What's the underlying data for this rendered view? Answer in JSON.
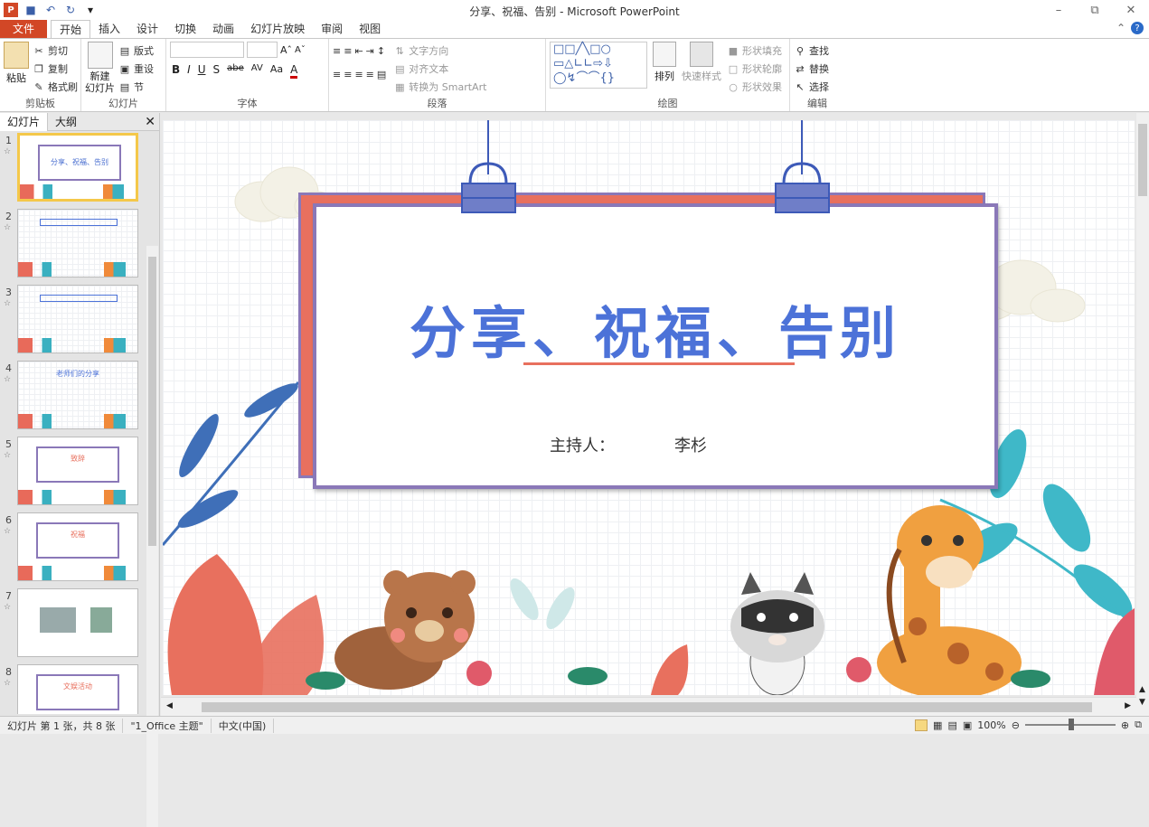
{
  "window": {
    "title": "分享、祝福、告别 - Microsoft PowerPoint",
    "app_icon": "P"
  },
  "tabs": [
    "文件",
    "开始",
    "插入",
    "设计",
    "切换",
    "动画",
    "幻灯片放映",
    "审阅",
    "视图"
  ],
  "ribbon": {
    "clipboard": {
      "label": "剪贴板",
      "paste": "粘贴",
      "cut": "剪切",
      "copy": "复制",
      "format_painter": "格式刷"
    },
    "slides": {
      "label": "幻灯片",
      "new_slide": "新建\n幻灯片",
      "layout": "版式",
      "reset": "重设",
      "section": "节"
    },
    "font": {
      "label": "字体",
      "buttons": [
        "B",
        "I",
        "U",
        "S",
        "abe",
        "AV",
        "Aa",
        "A"
      ]
    },
    "paragraph": {
      "label": "段落",
      "text_direction": "文字方向",
      "align_text": "对齐文本",
      "smartart": "转换为 SmartArt"
    },
    "drawing": {
      "label": "绘图",
      "arrange": "排列",
      "quick_styles": "快速样式",
      "shape_fill": "形状填充",
      "shape_outline": "形状轮廓",
      "shape_effects": "形状效果"
    },
    "editing": {
      "label": "编辑",
      "find": "查找",
      "replace": "替换",
      "select": "选择"
    }
  },
  "left_pane": {
    "tabs": [
      "幻灯片",
      "大纲"
    ],
    "thumbnails": [
      {
        "num": "1",
        "text": "分享、祝福、告别"
      },
      {
        "num": "2",
        "text": ""
      },
      {
        "num": "3",
        "text": ""
      },
      {
        "num": "4",
        "text": "老师们的分享"
      },
      {
        "num": "5",
        "text": "致辞"
      },
      {
        "num": "6",
        "text": "祝福"
      },
      {
        "num": "7",
        "text": ""
      },
      {
        "num": "8",
        "text": "文娱活动"
      }
    ]
  },
  "slide": {
    "title": "分享、祝福、告别",
    "host_label": "主持人：",
    "host_name": "李杉"
  },
  "status": {
    "slide_info": "幻灯片 第 1 张，共 8 张",
    "theme": "\"1_Office 主题\"",
    "language": "中文(中国)",
    "zoom": "100%"
  }
}
